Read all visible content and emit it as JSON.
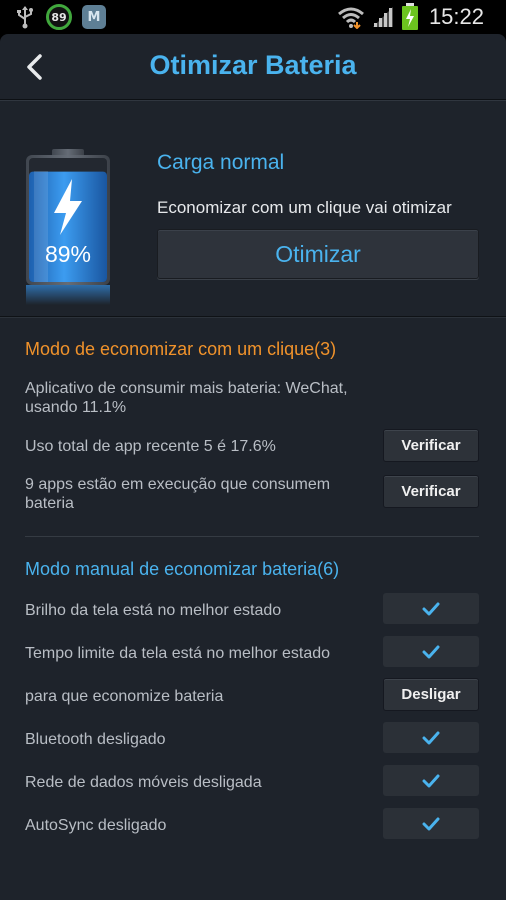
{
  "status_bar": {
    "battery_badge": "89",
    "app_badge": "M",
    "time": "15:22",
    "icons": [
      "usb-icon",
      "battery-saver-badge-icon",
      "app-notification-icon",
      "wifi-icon",
      "cell-signal-icon",
      "battery-charging-icon"
    ]
  },
  "header": {
    "title": "Otimizar Bateria",
    "back_icon": "chevron-left-icon"
  },
  "battery": {
    "level": 89,
    "label": "89%",
    "icon": "lightning-bolt-icon"
  },
  "status": {
    "title": "Carga normal",
    "description": "Economizar com um clique vai otimizar",
    "button_label": "Otimizar"
  },
  "one_click": {
    "title": "Modo de economizar com um clique(3)",
    "rows": [
      {
        "text": "Aplicativo de consumir mais bateria: WeChat, usando 11.1%"
      },
      {
        "text": "Uso total de app recente 5 é 17.6%",
        "button": "Verificar"
      },
      {
        "text": "9 apps estão em execução que consumem bateria",
        "button": "Verificar"
      }
    ]
  },
  "manual": {
    "title": "Modo manual de economizar bateria(6)",
    "rows": [
      {
        "text": "Brilho da tela está no melhor estado",
        "state": "checked"
      },
      {
        "text": "Tempo limite da tela está no melhor estado",
        "state": "checked"
      },
      {
        "text": "para que economize bateria",
        "button": "Desligar"
      },
      {
        "text": "Bluetooth desligado",
        "state": "checked"
      },
      {
        "text": "Rede de dados móveis desligada",
        "state": "checked"
      },
      {
        "text": "AutoSync desligado",
        "state": "checked"
      }
    ]
  },
  "colors": {
    "accent_blue": "#4ab3ee",
    "accent_orange": "#f0922b",
    "background": "#1e232b",
    "charging_green": "#6cc41f"
  }
}
